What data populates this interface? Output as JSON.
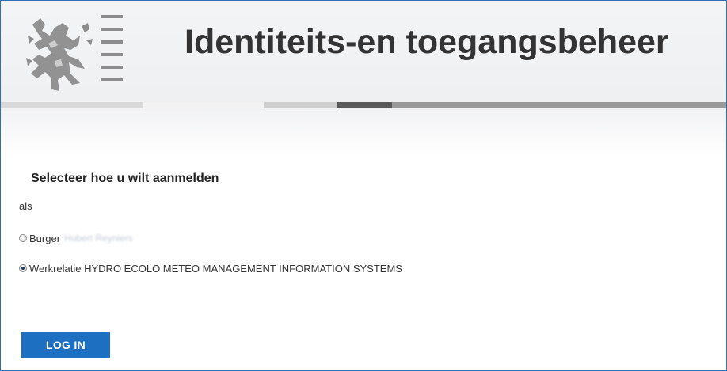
{
  "header": {
    "title": "Identiteits-en toegangsbeheer",
    "logo_icon": "flanders-lion-logo-icon"
  },
  "colors": {
    "accent": "#1d6fc1",
    "border": "#2f6fb5",
    "title": "#333333"
  },
  "form": {
    "heading": "Selecteer hoe u wilt aanmelden",
    "as_label": "als",
    "options": [
      {
        "label": "Burger",
        "detail": "Hubert Reyniers",
        "checked": false
      },
      {
        "label": "Werkrelatie HYDRO ECOLO METEO MANAGEMENT INFORMATION SYSTEMS",
        "detail": "",
        "checked": true
      }
    ],
    "login_label": "LOG IN"
  }
}
